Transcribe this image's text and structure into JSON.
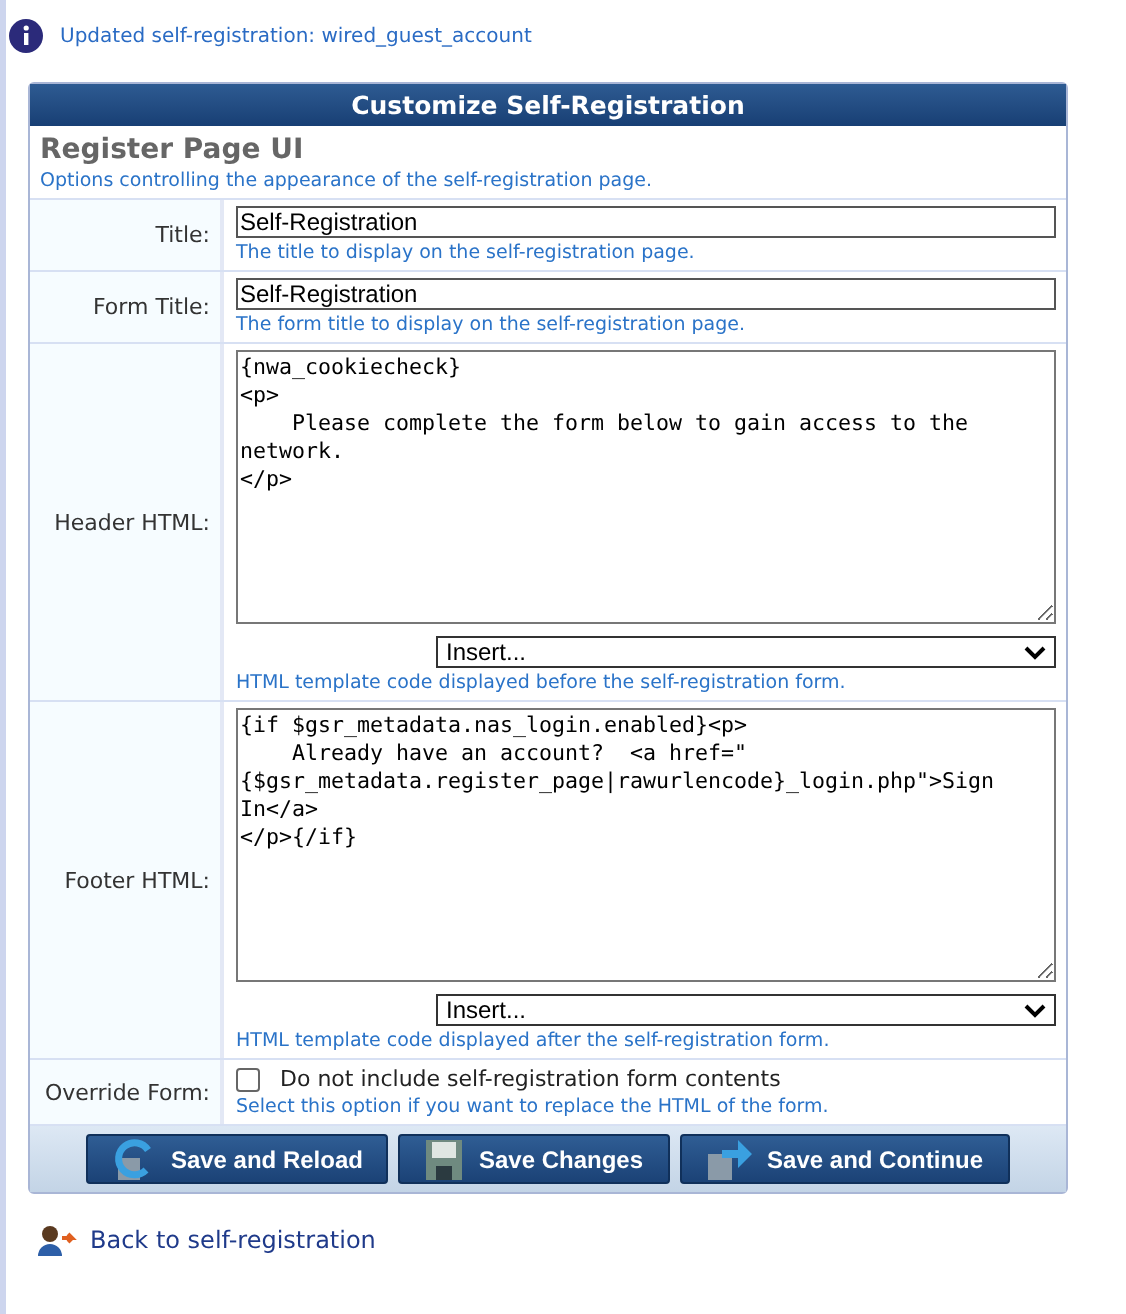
{
  "notice": {
    "text": "Updated self-registration: wired_guest_account"
  },
  "panel": {
    "title": "Customize Self-Registration",
    "section_title": "Register Page UI",
    "section_description": "Options controlling the appearance of the self-registration page.",
    "rows": [
      {
        "kind": "text",
        "label": "Title:",
        "value": "Self-Registration",
        "help": "The title to display on the self-registration page."
      },
      {
        "kind": "text",
        "label": "Form Title:",
        "value": "Self-Registration",
        "help": "The form title to display on the self-registration page."
      },
      {
        "kind": "html",
        "label": "Header HTML:",
        "value": "{nwa_cookiecheck}\n<p>\n    Please complete the form below to gain access to the network.\n</p>",
        "select": "Insert...",
        "help": "HTML template code displayed before the self-registration form."
      },
      {
        "kind": "html",
        "label": "Footer HTML:",
        "value": "{if $gsr_metadata.nas_login.enabled}<p>\n    Already have an account?  <a href=\"{$gsr_metadata.register_page|rawurlencode}_login.php\">Sign In</a>\n</p>{/if}",
        "select": "Insert...",
        "help": "HTML template code displayed after the self-registration form."
      },
      {
        "kind": "checkbox",
        "label": "Override Form:",
        "checked": false,
        "value": "Do not include self-registration form contents",
        "help": "Select this option if you want to replace the HTML of the form."
      }
    ],
    "buttons": [
      {
        "kind": "reload",
        "label": "Save and Reload"
      },
      {
        "kind": "save",
        "label": "Save Changes"
      },
      {
        "kind": "continue",
        "label": "Save and Continue"
      }
    ]
  },
  "back_link": "Back to self-registration"
}
